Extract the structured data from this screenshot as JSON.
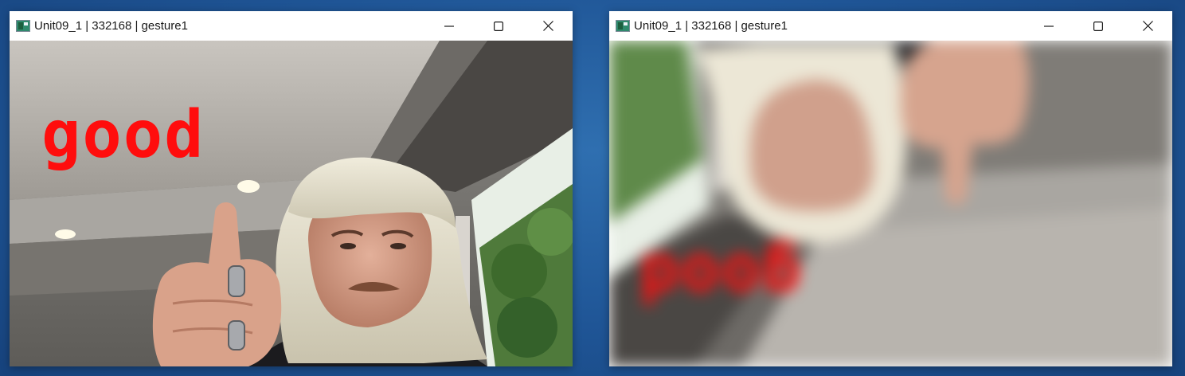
{
  "windows": [
    {
      "title": "Unit09_1 | 332168 | gesture1",
      "overlay_text": "good",
      "overlay_color": "#ff0d0d",
      "view": "normal"
    },
    {
      "title": "Unit09_1 | 332168 | gesture1",
      "overlay_text": "good",
      "overlay_color": "#ff0d0d",
      "view": "flipped-blurred"
    }
  ],
  "controls": {
    "minimize_icon": "minimize-icon",
    "maximize_icon": "maximize-icon",
    "close_icon": "close-icon"
  },
  "colors": {
    "desktop": "#1f5596",
    "titlebar": "#ffffff",
    "overlay": "#ff0d0d"
  }
}
